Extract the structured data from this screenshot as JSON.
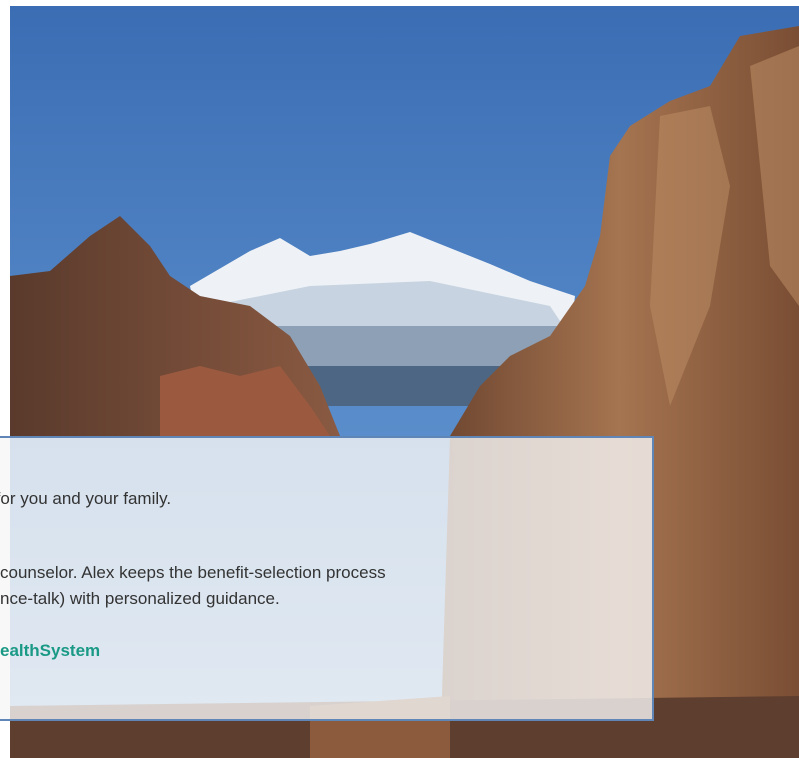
{
  "hero": {
    "image_description": "mountain-canyon-photo",
    "colors": {
      "sky": "#3f72b6",
      "snow": "#f2f4f6",
      "rock": "#8a5a3e",
      "border": "#5f86b7",
      "brand": "#1a9a86"
    }
  },
  "card": {
    "line1": "es for you and your family.",
    "paragraph2_line1": "counselor. Alex keeps the benefit-selection process",
    "paragraph2_line2": "nce-talk) with personalized guidance.",
    "signature": "ealthSystem"
  }
}
